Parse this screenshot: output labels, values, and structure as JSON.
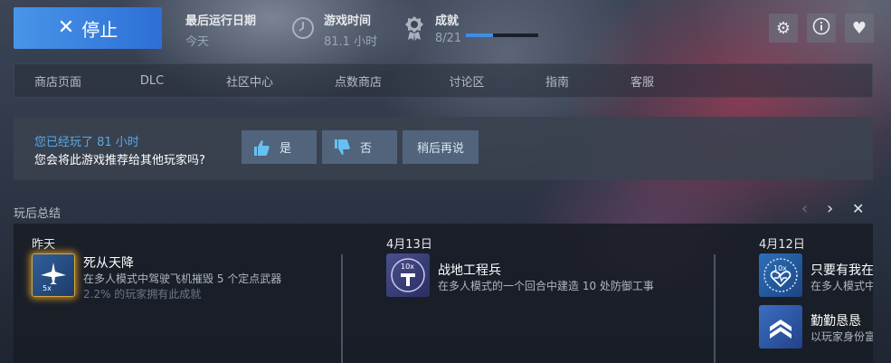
{
  "top": {
    "stop_label": "停止",
    "last_run_label": "最后运行日期",
    "last_run_value": "今天",
    "play_time_label": "游戏时间",
    "play_time_value": "81.1 小时",
    "achievements_label": "成就",
    "achievements_value": "8/21",
    "achievements_progress": 0.381,
    "icons": [
      "gear-icon",
      "info-icon",
      "heart-icon"
    ]
  },
  "nav": {
    "items": [
      "商店页面",
      "DLC",
      "社区中心",
      "点数商店",
      "讨论区",
      "指南",
      "客服"
    ]
  },
  "recommend": {
    "played": "您已经玩了 81 小时",
    "question": "您会将此游戏推荐给其他玩家吗?",
    "yes": "是",
    "no": "否",
    "later": "稍后再说"
  },
  "summary": {
    "title": "玩后总结",
    "columns": [
      {
        "date": "昨天",
        "achievements": [
          {
            "name": "死从天降",
            "desc": "在多人模式中驾驶飞机摧毁 5 个定点武器",
            "pct": "2.2% 的玩家拥有此成就",
            "badge_text": "5x"
          }
        ]
      },
      {
        "date": "4月13日",
        "achievements": [
          {
            "name": "战地工程兵",
            "desc": "在多人模式的一个回合中建造 10 处防御工事",
            "badge_text": "10x"
          }
        ]
      },
      {
        "date": "4月12日",
        "achievements": [
          {
            "name": "只要有我在",
            "desc": "在多人模式中",
            "badge_text": "10x"
          },
          {
            "name": "勤勤恳恳",
            "desc": "以玩家身份富"
          }
        ]
      }
    ]
  },
  "colors": {
    "accent_blue": "#3a8fe8",
    "link_blue": "#5aa9e6"
  }
}
